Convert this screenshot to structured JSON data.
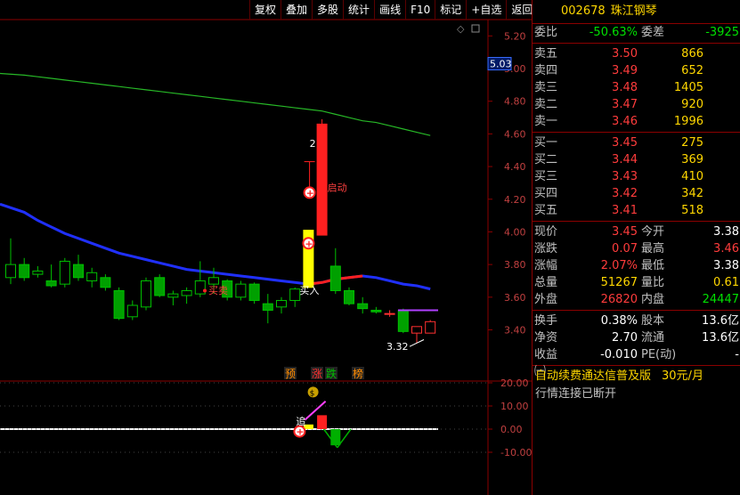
{
  "toolbar": [
    "复权",
    "叠加",
    "多股",
    "统计",
    "画线",
    "F10",
    "标记",
    "+自选",
    "返回"
  ],
  "stock": {
    "code": "002678",
    "name": "珠江钢琴"
  },
  "commission": {
    "ratio_label": "委比",
    "ratio": "-50.63%",
    "diff_label": "委差",
    "diff": "-3925"
  },
  "asks": [
    {
      "label": "卖五",
      "price": "3.50",
      "vol": "866"
    },
    {
      "label": "卖四",
      "price": "3.49",
      "vol": "652"
    },
    {
      "label": "卖三",
      "price": "3.48",
      "vol": "1405"
    },
    {
      "label": "卖二",
      "price": "3.47",
      "vol": "920"
    },
    {
      "label": "卖一",
      "price": "3.46",
      "vol": "1996"
    }
  ],
  "bids": [
    {
      "label": "买一",
      "price": "3.45",
      "vol": "275"
    },
    {
      "label": "买二",
      "price": "3.44",
      "vol": "369"
    },
    {
      "label": "买三",
      "price": "3.43",
      "vol": "410"
    },
    {
      "label": "买四",
      "price": "3.42",
      "vol": "342"
    },
    {
      "label": "买五",
      "price": "3.41",
      "vol": "518"
    }
  ],
  "quote": [
    {
      "l": "现价",
      "v": "3.45",
      "vc": "red",
      "l2": "今开",
      "v2": "3.38",
      "v2c": "white"
    },
    {
      "l": "涨跌",
      "v": "0.07",
      "vc": "red",
      "l2": "最高",
      "v2": "3.46",
      "v2c": "red"
    },
    {
      "l": "涨幅",
      "v": "2.07%",
      "vc": "red",
      "l2": "最低",
      "v2": "3.38",
      "v2c": "white"
    },
    {
      "l": "总量",
      "v": "51267",
      "vc": "yellow",
      "l2": "量比",
      "v2": "0.61",
      "v2c": "yellow"
    },
    {
      "l": "外盘",
      "v": "26820",
      "vc": "red",
      "l2": "内盘",
      "v2": "24447",
      "v2c": "green"
    }
  ],
  "finance": [
    {
      "l": "换手",
      "v": "0.38%",
      "l2": "股本",
      "v2": "13.6亿"
    },
    {
      "l": "净资",
      "v": "2.70",
      "l2": "流通",
      "v2": "13.6亿"
    },
    {
      "l": "收益㈠",
      "v": "-0.010",
      "l2": "PE(动)",
      "v2": "-"
    }
  ],
  "promo": {
    "text": "自动续费通达信普及版",
    "price": "30元/月"
  },
  "status": "行情连接已断开",
  "chart_data": [
    {
      "type": "candlestick",
      "ylim": [
        3.25,
        5.3
      ],
      "yticks": [
        "5.20",
        "5.00",
        "4.80",
        "4.60",
        "4.40",
        "4.20",
        "4.00",
        "3.80",
        "3.60",
        "3.40"
      ],
      "current_price_label": "5.03",
      "min_label": "3.32",
      "annotations": [
        "2",
        "启动",
        "买入",
        "买卖"
      ],
      "bottom_labels": [
        "预",
        "涨",
        "跌",
        "榜"
      ],
      "candles": [
        {
          "o": 3.72,
          "h": 3.96,
          "l": 3.68,
          "c": 3.8
        },
        {
          "o": 3.8,
          "h": 3.84,
          "l": 3.7,
          "c": 3.72
        },
        {
          "o": 3.74,
          "h": 3.79,
          "l": 3.72,
          "c": 3.76
        },
        {
          "o": 3.7,
          "h": 3.8,
          "l": 3.66,
          "c": 3.67
        },
        {
          "o": 3.68,
          "h": 3.84,
          "l": 3.66,
          "c": 3.82
        },
        {
          "o": 3.8,
          "h": 3.86,
          "l": 3.7,
          "c": 3.72
        },
        {
          "o": 3.7,
          "h": 3.78,
          "l": 3.66,
          "c": 3.75
        },
        {
          "o": 3.72,
          "h": 3.74,
          "l": 3.64,
          "c": 3.66
        },
        {
          "o": 3.64,
          "h": 3.66,
          "l": 3.46,
          "c": 3.47
        },
        {
          "o": 3.48,
          "h": 3.58,
          "l": 3.46,
          "c": 3.55
        },
        {
          "o": 3.54,
          "h": 3.72,
          "l": 3.52,
          "c": 3.7
        },
        {
          "o": 3.72,
          "h": 3.74,
          "l": 3.6,
          "c": 3.61
        },
        {
          "o": 3.6,
          "h": 3.64,
          "l": 3.55,
          "c": 3.62
        },
        {
          "o": 3.61,
          "h": 3.66,
          "l": 3.56,
          "c": 3.64
        },
        {
          "o": 3.62,
          "h": 3.82,
          "l": 3.6,
          "c": 3.7
        },
        {
          "o": 3.68,
          "h": 3.78,
          "l": 3.62,
          "c": 3.72
        },
        {
          "o": 3.7,
          "h": 3.71,
          "l": 3.58,
          "c": 3.6
        },
        {
          "o": 3.6,
          "h": 3.7,
          "l": 3.58,
          "c": 3.68
        },
        {
          "o": 3.68,
          "h": 3.69,
          "l": 3.56,
          "c": 3.58
        },
        {
          "o": 3.56,
          "h": 3.62,
          "l": 3.44,
          "c": 3.52
        },
        {
          "o": 3.54,
          "h": 3.6,
          "l": 3.5,
          "c": 3.58
        },
        {
          "o": 3.58,
          "h": 3.66,
          "l": 3.54,
          "c": 3.65
        },
        {
          "o": 3.66,
          "h": 4.01,
          "l": 3.66,
          "c": 4.01
        },
        {
          "o": 3.98,
          "h": 4.69,
          "l": 3.98,
          "c": 4.66
        },
        {
          "o": 3.79,
          "h": 3.9,
          "l": 3.62,
          "c": 3.64
        },
        {
          "o": 3.64,
          "h": 3.66,
          "l": 3.55,
          "c": 3.56
        },
        {
          "o": 3.56,
          "h": 3.6,
          "l": 3.5,
          "c": 3.53
        },
        {
          "o": 3.52,
          "h": 3.54,
          "l": 3.5,
          "c": 3.51
        },
        {
          "o": 3.5,
          "h": 3.52,
          "l": 3.48,
          "c": 3.5
        },
        {
          "o": 3.52,
          "h": 3.53,
          "l": 3.38,
          "c": 3.39
        },
        {
          "o": 3.38,
          "h": 3.42,
          "l": 3.32,
          "c": 3.42
        },
        {
          "o": 3.38,
          "h": 3.46,
          "l": 3.38,
          "c": 3.45
        }
      ],
      "ma_green": [
        4.97,
        4.96,
        4.95,
        4.94,
        4.93,
        4.92,
        4.91,
        4.9,
        4.89,
        4.88,
        4.87,
        4.86,
        4.85,
        4.84,
        4.83,
        4.82,
        4.81,
        4.8,
        4.79,
        4.78,
        4.77,
        4.76,
        4.75,
        4.74,
        4.72,
        4.7,
        4.68,
        4.67,
        4.65,
        4.63,
        4.61,
        4.59
      ],
      "ma_blue": [
        4.17,
        4.12,
        4.07,
        4.03,
        3.99,
        3.96,
        3.93,
        3.9,
        3.87,
        3.85,
        3.83,
        3.81,
        3.79,
        3.77,
        3.76,
        3.75,
        3.74,
        3.73,
        3.72,
        3.71,
        3.7,
        3.69,
        3.68,
        3.69,
        3.71,
        3.72,
        3.73,
        3.72,
        3.7,
        3.68,
        3.67,
        3.65
      ]
    },
    {
      "type": "bar",
      "ylim": [
        -20,
        30
      ],
      "yticks": [
        "20.00",
        "10.00",
        "0.00",
        "-10.00"
      ],
      "annotations": [
        "追"
      ],
      "values": [
        0,
        0,
        0,
        0,
        0,
        0,
        0,
        0,
        0,
        0,
        0,
        0,
        0,
        0,
        0,
        0,
        0,
        0,
        0,
        0,
        0,
        0,
        2,
        6,
        -7,
        0,
        0,
        0,
        0,
        0,
        0,
        0
      ]
    }
  ]
}
